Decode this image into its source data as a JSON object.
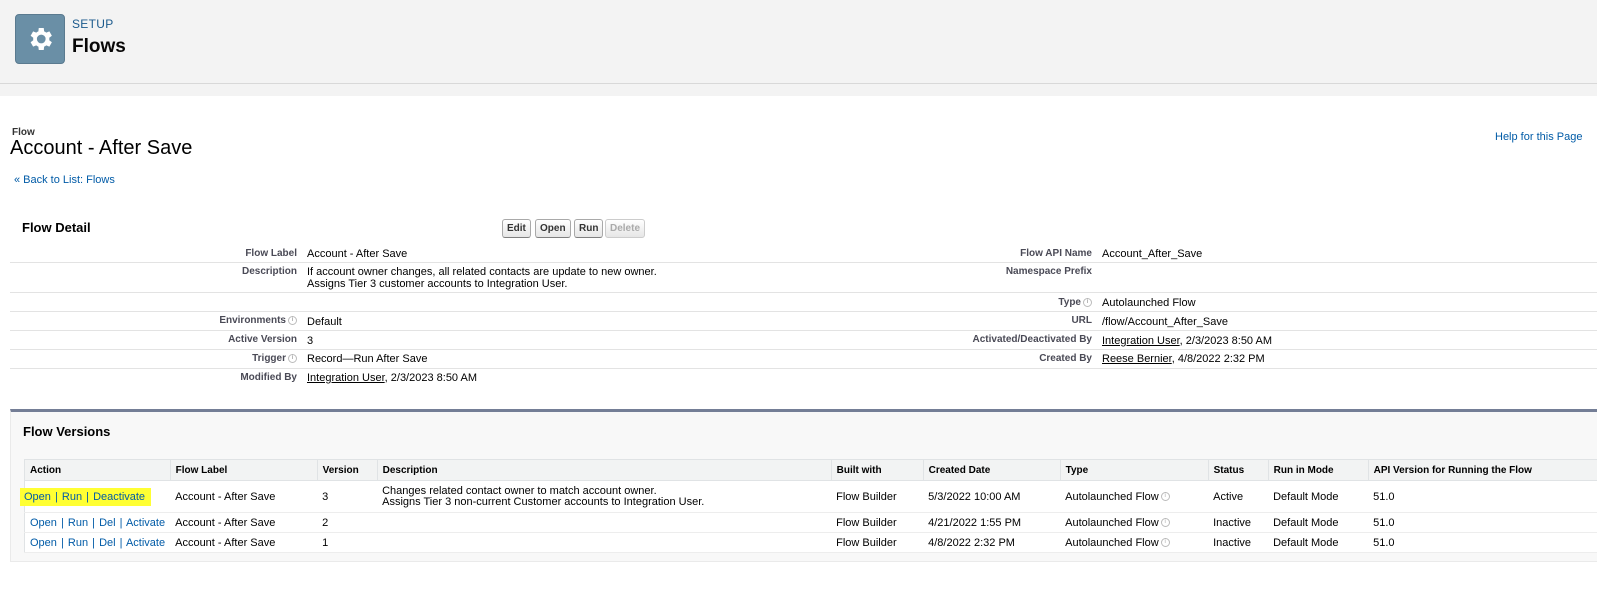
{
  "header": {
    "section": "SETUP",
    "title": "Flows",
    "icon": "gear-icon"
  },
  "page": {
    "type_label": "Flow",
    "title": "Account - After Save",
    "help_link": "Help for this Page",
    "back_link": "« Back to List: Flows"
  },
  "detail": {
    "title": "Flow Detail",
    "buttons": {
      "edit": "Edit",
      "open": "Open",
      "run": "Run",
      "delete": "Delete"
    },
    "flow_label": {
      "label": "Flow Label",
      "value": "Account - After Save"
    },
    "description": {
      "label": "Description",
      "line1": "If account owner changes, all related contacts are update to new owner.",
      "line2": "Assigns Tier 3 customer accounts to Integration User."
    },
    "environments": {
      "label": "Environments",
      "value": "Default"
    },
    "active_version": {
      "label": "Active Version",
      "value": "3"
    },
    "trigger": {
      "label": "Trigger",
      "value": "Record—Run After Save"
    },
    "modified_by": {
      "label": "Modified By",
      "user": "Integration User",
      "date": ", 2/3/2023 8:50 AM"
    },
    "api_name": {
      "label": "Flow API Name",
      "value": "Account_After_Save"
    },
    "namespace_prefix": {
      "label": "Namespace Prefix",
      "value": ""
    },
    "type": {
      "label": "Type",
      "value": "Autolaunched Flow"
    },
    "url": {
      "label": "URL",
      "value": "/flow/Account_After_Save"
    },
    "activated_by": {
      "label": "Activated/Deactivated By",
      "user": "Integration User",
      "date": ", 2/3/2023 8:50 AM"
    },
    "created_by": {
      "label": "Created By",
      "user": "Reese Bernier",
      "date": ", 4/8/2022 2:32 PM"
    }
  },
  "versions": {
    "title": "Flow Versions",
    "columns": [
      "Action",
      "Flow Label",
      "Version",
      "Description",
      "Built with",
      "Created Date",
      "Type",
      "Status",
      "Run in Mode",
      "API Version for Running the Flow"
    ],
    "actions": {
      "open": "Open",
      "run": "Run",
      "del": "Del",
      "activate": "Activate",
      "deactivate": "Deactivate",
      "sep": "|"
    },
    "rows": [
      {
        "flow_label": "Account - After Save",
        "version": "3",
        "desc1": "Changes related contact owner to match account owner.",
        "desc2": "Assigns Tier 3 non-current Customer accounts to Integration User.",
        "built_with": "Flow Builder",
        "created": "5/3/2022 10:00 AM",
        "type": "Autolaunched Flow",
        "status": "Active",
        "mode": "Default Mode",
        "api": "51.0"
      },
      {
        "flow_label": "Account - After Save",
        "version": "2",
        "desc1": "",
        "desc2": "",
        "built_with": "Flow Builder",
        "created": "4/21/2022 1:55 PM",
        "type": "Autolaunched Flow",
        "status": "Inactive",
        "mode": "Default Mode",
        "api": "51.0"
      },
      {
        "flow_label": "Account - After Save",
        "version": "1",
        "desc1": "",
        "desc2": "",
        "built_with": "Flow Builder",
        "created": "4/8/2022 2:32 PM",
        "type": "Autolaunched Flow",
        "status": "Inactive",
        "mode": "Default Mode",
        "api": "51.0"
      }
    ]
  },
  "colors": {
    "link": "#015ba7",
    "highlight": "#ffff33",
    "icon_bg": "#6a8fa6",
    "versions_border": "#747e96"
  }
}
